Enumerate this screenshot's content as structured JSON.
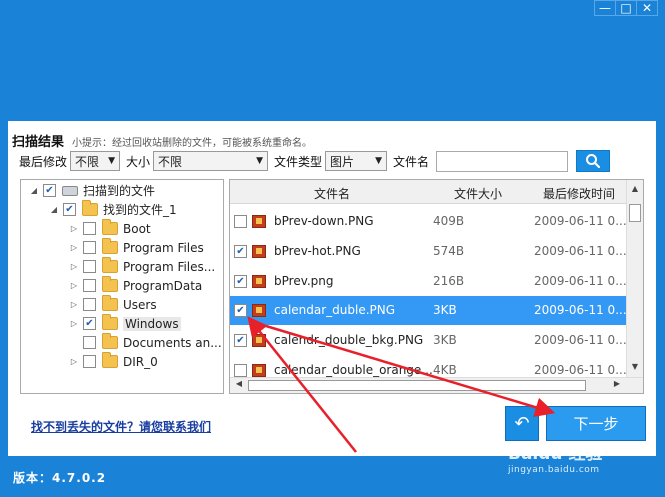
{
  "window": {
    "controls": [
      "—",
      "□",
      "✕"
    ]
  },
  "header": {
    "title": "扫描结果",
    "tip": "小提示：经过回收站删除的文件，可能被系统重命名。"
  },
  "filters": {
    "modified_label": "最后修改",
    "modified_value": "不限",
    "size_label": "大小",
    "size_value": "不限",
    "type_label": "文件类型",
    "type_value": "图片",
    "name_label": "文件名",
    "name_value": ""
  },
  "tree": {
    "root": "扫描到的文件",
    "found": "找到的文件_1",
    "items": [
      "Boot",
      "Program Files",
      "Program Files...",
      "ProgramData",
      "Users",
      "Windows",
      "Documents an...",
      "DIR_0"
    ]
  },
  "files": {
    "columns": [
      "文件名",
      "文件大小",
      "最后修改时间"
    ],
    "rows": [
      {
        "name": "bPrev-down.PNG",
        "size": "409B",
        "date": "2009-06-11 0..."
      },
      {
        "name": "bPrev-hot.PNG",
        "size": "574B",
        "date": "2009-06-11 0..."
      },
      {
        "name": "bPrev.png",
        "size": "216B",
        "date": "2009-06-11 0..."
      },
      {
        "name": "calendar_duble.PNG",
        "size": "3KB",
        "date": "2009-06-11 0..."
      },
      {
        "name": "calendr_double_bkg.PNG",
        "size": "3KB",
        "date": "2009-06-11 0..."
      },
      {
        "name": "calendar_double_orange...",
        "size": "4KB",
        "date": "2009-06-11 0..."
      }
    ]
  },
  "footer": {
    "contact_link": "找不到丢失的文件？请您联系我们",
    "back_icon": "↶",
    "next_label": "下一步",
    "version": "版本：4.7.0.2"
  },
  "watermark": {
    "main": "Baidu 经验",
    "url": "jingyan.baidu.com"
  },
  "colors": {
    "brand_blue": "#1a83d8",
    "selected_row": "#3399f5",
    "arrow_red": "#e8202a"
  }
}
